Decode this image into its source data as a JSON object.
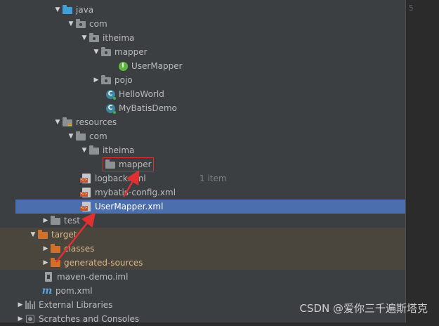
{
  "editor": {
    "line_number": "5"
  },
  "tree": {
    "items": [
      {
        "label": "java",
        "icon": "source-folder-icon",
        "expanded": true
      },
      {
        "label": "com",
        "icon": "package-icon",
        "expanded": true
      },
      {
        "label": "itheima",
        "icon": "package-icon",
        "expanded": true
      },
      {
        "label": "mapper",
        "icon": "package-icon",
        "expanded": true
      },
      {
        "label": "UserMapper",
        "icon": "interface-icon",
        "badge": "I"
      },
      {
        "label": "pojo",
        "icon": "package-icon",
        "expanded": false
      },
      {
        "label": "HelloWorld",
        "icon": "class-icon",
        "badge": "C"
      },
      {
        "label": "MyBatisDemo",
        "icon": "class-icon",
        "badge": "C"
      },
      {
        "label": "resources",
        "icon": "resources-folder-icon",
        "expanded": true
      },
      {
        "label": "com",
        "icon": "folder-icon",
        "expanded": true
      },
      {
        "label": "itheima",
        "icon": "folder-icon",
        "expanded": true
      },
      {
        "label": "mapper",
        "icon": "folder-icon"
      },
      {
        "label": "logback.xml",
        "icon": "xml-file-icon"
      },
      {
        "label": "mybatis-config.xml",
        "icon": "xml-file-icon"
      },
      {
        "label": "UserMapper.xml",
        "icon": "xml-file-icon"
      },
      {
        "label": "test",
        "icon": "folder-icon",
        "expanded": false
      },
      {
        "label": "target",
        "icon": "excluded-folder-icon",
        "expanded": true
      },
      {
        "label": "classes",
        "icon": "excluded-folder-icon",
        "expanded": false
      },
      {
        "label": "generated-sources",
        "icon": "excluded-folder-icon",
        "expanded": false
      },
      {
        "label": "maven-demo.iml",
        "icon": "iml-file-icon"
      },
      {
        "label": "pom.xml",
        "icon": "maven-icon",
        "badge": "m"
      },
      {
        "label": "External Libraries",
        "icon": "libraries-icon",
        "expanded": false
      },
      {
        "label": "Scratches and Consoles",
        "icon": "scratches-icon",
        "expanded": false
      }
    ],
    "hint": "1 item",
    "selection_color": "#4b6eaf",
    "excluded_color": "#4a463e"
  },
  "annotation": {
    "color": "#e03030"
  },
  "watermark": "CSDN @爱你三千遍斯塔克"
}
